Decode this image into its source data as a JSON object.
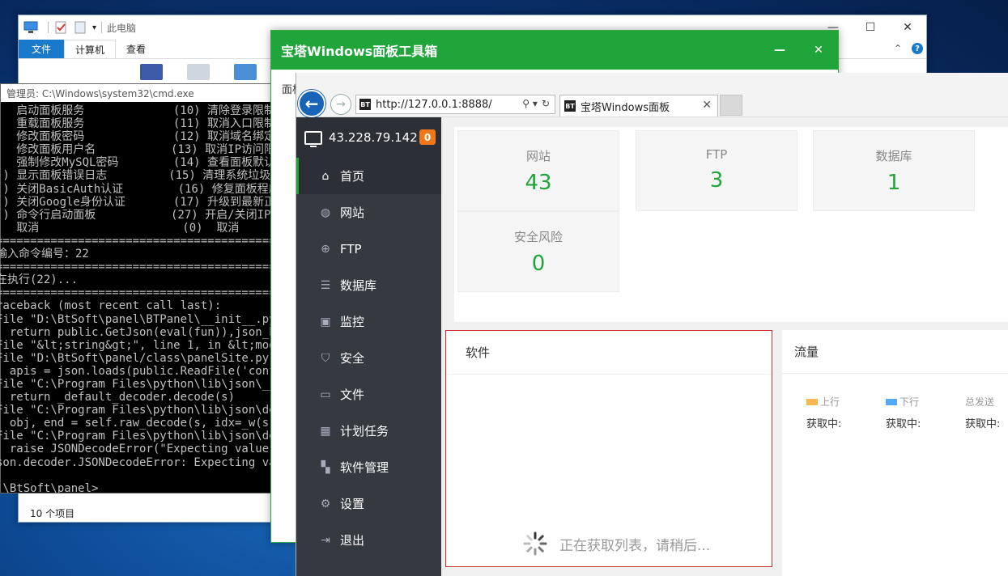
{
  "explorer": {
    "title": "此电脑",
    "tabs": [
      "文件",
      "计算机",
      "查看"
    ],
    "status": "10 个项目",
    "controls": {
      "min": "—",
      "max": "☐",
      "close": "✕"
    },
    "help": "?"
  },
  "cmd": {
    "title": "管理员: C:\\Windows\\system32\\cmd.exe",
    "lines": [
      "   启动面板服务             (10) 清除登录限制",
      "   重载面板服务             (11) 取消入口限制",
      "   修改面板密码             (12) 取消域名绑定",
      "   修改面板用户名           (13) 取消IP访问限",
      "   强制修改MySQL密码        (14) 查看面板默认",
      " ) 显示面板错误日志         (15) 清理系统垃圾",
      " ) 关闭BasicAuth认证        (16) 修复面板程序",
      " ) 关闭Google身份认证       (17) 升级到最新正",
      " ) 命令行启动面板           (27) 开启/关闭IPv",
      "   取消                     (0)  取消",
      "==================================================",
      "输入命令编号：22",
      "==================================================",
      "在执行(22)...",
      "==================================================",
      "raceback (most recent call last):",
      "File \"D:\\BtSoft\\panel\\BTPanel\\__init__.py\",",
      "  return public.GetJson(eval(fun)),json_hea",
      "File \"&lt;string&gt;\", line 1, in &lt;modul",
      "File \"D:\\BtSoft\\panel/class\\panelSite.py\",",
      "  apis = json.loads(public.ReadFile('config",
      "File \"C:\\Program Files\\python\\lib\\json\\__in",
      "  return _default_decoder.decode(s)",
      "File \"C:\\Program Files\\python\\lib\\json\\deco",
      "  obj, end = self.raw_decode(s, idx=_w(s, 0",
      "File \"C:\\Program Files\\python\\lib\\json\\deco",
      "  raise JSONDecodeError(\"Expecting value\",",
      "son.decoder.JSONDecodeError: Expecting value",
      "",
      ":\\BtSoft\\panel>"
    ]
  },
  "toolbox": {
    "title": "宝塔Windows面板工具箱",
    "subtab": "面板",
    "controls": {
      "min": "—",
      "close": "✕"
    }
  },
  "browser": {
    "url": "http://127.0.0.1:8888/",
    "tab_title": "宝塔Windows面板",
    "favicon": "BT",
    "nav": {
      "back": "←",
      "forward": "→",
      "search": "⚲ ▾",
      "refresh": "↻",
      "close": "✕"
    }
  },
  "panel": {
    "server_ip": "43.228.79.142",
    "badge": "0",
    "menu": [
      {
        "label": "首页",
        "icon": "home-icon",
        "glyph": "⌂"
      },
      {
        "label": "网站",
        "icon": "globe-icon",
        "glyph": "◍"
      },
      {
        "label": "FTP",
        "icon": "ftp-icon",
        "glyph": "⊕"
      },
      {
        "label": "数据库",
        "icon": "database-icon",
        "glyph": "☰"
      },
      {
        "label": "监控",
        "icon": "monitor-icon",
        "glyph": "▣"
      },
      {
        "label": "安全",
        "icon": "shield-icon",
        "glyph": "⛉"
      },
      {
        "label": "文件",
        "icon": "folder-icon",
        "glyph": "▭"
      },
      {
        "label": "计划任务",
        "icon": "calendar-icon",
        "glyph": "▦"
      },
      {
        "label": "软件管理",
        "icon": "apps-icon",
        "glyph": "▚"
      },
      {
        "label": "设置",
        "icon": "gear-icon",
        "glyph": "⚙"
      },
      {
        "label": "退出",
        "icon": "logout-icon",
        "glyph": "⇥"
      }
    ],
    "stats": [
      {
        "label": "网站",
        "value": "43"
      },
      {
        "label": "FTP",
        "value": "3"
      },
      {
        "label": "数据库",
        "value": "1"
      },
      {
        "label": "安全风险",
        "value": "0"
      }
    ],
    "software": {
      "title": "软件",
      "loading": "正在获取列表，请稍后..."
    },
    "traffic": {
      "title": "流量",
      "columns": [
        {
          "label": "上行",
          "value": "获取中:",
          "color": "#f7b851"
        },
        {
          "label": "下行",
          "value": "获取中:",
          "color": "#52a9ff"
        },
        {
          "label": "总发送",
          "value": "获取中:",
          "color": ""
        }
      ]
    },
    "colors": {
      "accent": "#20a53a",
      "sidebar": "#353a41",
      "badge": "#f0771a",
      "highlight_border": "#c9302c"
    }
  }
}
